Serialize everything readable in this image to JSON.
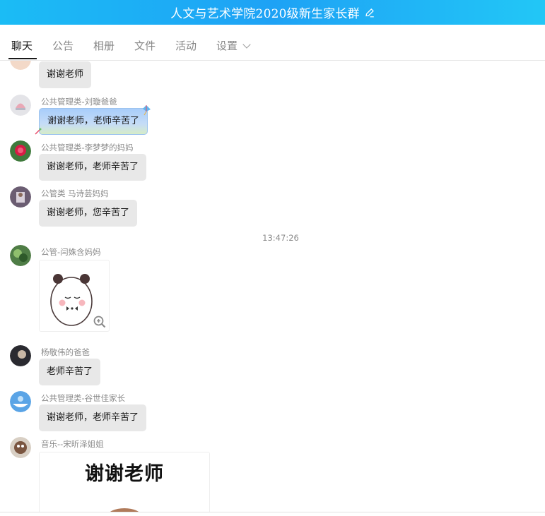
{
  "window": {
    "title": "人文与艺术学院2020级新生家长群",
    "edit_icon": "pencil-icon"
  },
  "tabs": [
    {
      "label": "聊天",
      "active": true
    },
    {
      "label": "公告"
    },
    {
      "label": "相册"
    },
    {
      "label": "文件"
    },
    {
      "label": "活动"
    },
    {
      "label": "设置",
      "dropdown": true
    }
  ],
  "messages": [
    {
      "sender": "",
      "text": "谢谢老师"
    },
    {
      "sender": "公共管理类-刘璇爸爸",
      "text": "谢谢老师，老师辛苦了",
      "style": "fancy"
    },
    {
      "sender": "公共管理类-李梦梦的妈妈",
      "text": "谢谢老师，老师辛苦了"
    },
    {
      "sender": "公管类  马诗芸妈妈",
      "text": "谢谢老师，您辛苦了"
    },
    {
      "sender": "公管-闫姝含妈妈",
      "type": "sticker"
    },
    {
      "sender": "杨敬伟的爸爸",
      "text": "老师辛苦了"
    },
    {
      "sender": "公共管理类-谷世佳家长",
      "text": "谢谢老师，老师辛苦了"
    },
    {
      "sender": "音乐--宋昕泽姐姐",
      "type": "sticker",
      "sticker_text": "谢谢老师"
    }
  ],
  "timestamp": "13:47:26",
  "colors": {
    "titlebar": "#1ea2f5",
    "bubble": "#e8e8e8",
    "accent_tab": "#1a1a1a"
  }
}
